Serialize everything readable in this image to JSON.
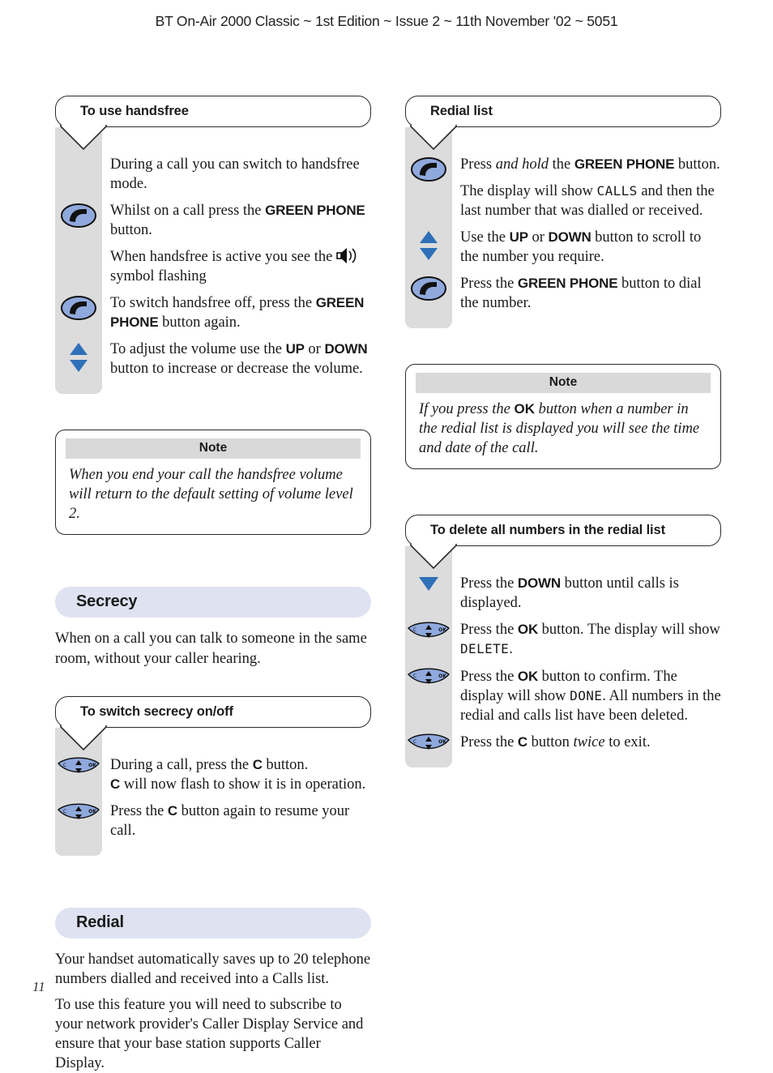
{
  "header": {
    "title": "BT On-Air 2000 Classic ~ 1st Edition ~ Issue 2 ~ 11th November '02 ~ 5051"
  },
  "folio": {
    "page_number": "11"
  },
  "colors": {
    "icon_blue": "#8fa9dd",
    "arrow_blue": "#2f70b8",
    "rail_grey": "#dcdcdc",
    "note_header_grey": "#d9d9d9",
    "section_pill": "#dfe2f1",
    "outline": "#2b2b2b"
  },
  "left_column": {
    "handsfree_procedure": {
      "title": "To use handsfree",
      "steps": [
        {
          "icon": "none",
          "text_html": "During a call you can switch to handsfree mode."
        },
        {
          "icon": "green-phone-button-icon",
          "text_html": "Whilst on a call press the <b>GREEN PHONE</b> button."
        },
        {
          "icon": "none",
          "text_html": "When handsfree is active you see the <span class=\"spk-slot\"></span> symbol flashing"
        },
        {
          "icon": "green-phone-button-icon",
          "text_html": "To switch handsfree off, press the <b>GREEN PHONE</b> button again."
        },
        {
          "icon": "up-down-button-icon",
          "text_html": "To adjust the volume use the <b>UP</b> or <b>DOWN</b> button to increase or decrease the volume."
        }
      ]
    },
    "handsfree_note": {
      "header": "Note",
      "body_html": "When you end your call the handsfree volume will return to the default setting of volume level 2."
    },
    "secrecy_section": {
      "heading": "Secrecy",
      "paragraphs": [
        "When on a call you can talk to someone in the same room, without your caller hearing."
      ]
    },
    "secrecy_procedure": {
      "title": "To switch secrecy on/off",
      "steps": [
        {
          "icon": "nav-key-icon",
          "text_html": "During a call, press the <b>C</b> button.<br><b>C</b> will now flash to show it is in operation."
        },
        {
          "icon": "nav-key-icon",
          "text_html": "Press the <b>C</b> button again to resume your call."
        }
      ]
    },
    "redial_section": {
      "heading": "Redial",
      "paragraphs": [
        "Your handset automatically saves up to 20 telephone numbers dialled and received into a Calls list.",
        "To use this feature you will need to subscribe to your network provider's Caller Display Service and ensure that your base station supports Caller Display."
      ]
    }
  },
  "right_column": {
    "redial_list_procedure": {
      "title": "Redial list",
      "steps": [
        {
          "icon": "green-phone-button-icon",
          "text_html": "Press <i>and hold</i> the <b>GREEN PHONE</b> button."
        },
        {
          "icon": "none",
          "text_html": "The display will show <span class=\"lcd\">CALLS</span> and then the last number that was dialled or received."
        },
        {
          "icon": "up-down-button-icon",
          "text_html": "Use the <b>UP</b> or <b>DOWN</b> button to scroll to the number you require."
        },
        {
          "icon": "green-phone-button-icon",
          "text_html": "Press the <b>GREEN PHONE</b> button to dial the number."
        }
      ]
    },
    "redial_note": {
      "header": "Note",
      "body_html": "If you press the <b>OK</b> button when a number in the redial list is displayed you will see the time and date of the call."
    },
    "delete_procedure": {
      "title": "To delete all numbers in the redial list",
      "steps": [
        {
          "icon": "down-button-icon",
          "text_html": "Press the <b>DOWN</b> button until calls is displayed."
        },
        {
          "icon": "nav-key-icon",
          "text_html": "Press the <b>OK</b> button. The display will show <span class=\"lcd\">DELETE</span>."
        },
        {
          "icon": "nav-key-icon",
          "text_html": "Press the <b>OK</b> button to confirm. The display will show <span class=\"lcd\">DONE</span>. All numbers in the redial and calls list have been deleted."
        },
        {
          "icon": "nav-key-icon",
          "text_html": "Press the <b>C</b> button <i>twice</i> to exit."
        }
      ]
    }
  }
}
